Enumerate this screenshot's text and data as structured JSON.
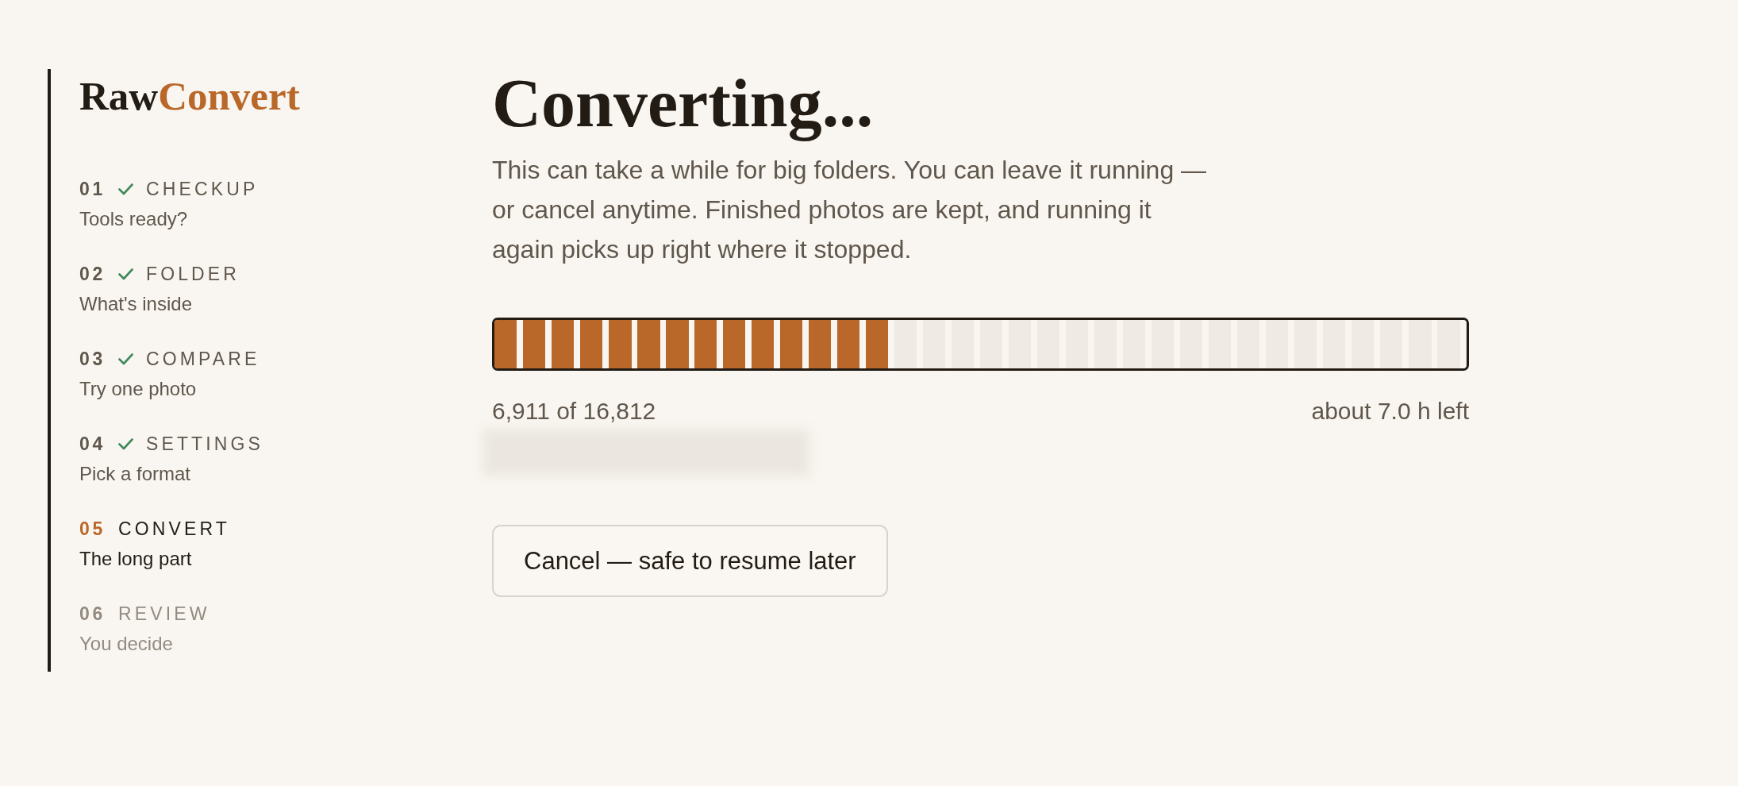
{
  "sidebar": {
    "logo": {
      "text": "Raw",
      "accent": "Convert"
    },
    "steps": [
      {
        "number": "01",
        "title": "CHECKUP",
        "subtitle": "Tools ready?",
        "completed": true,
        "selected": false
      },
      {
        "number": "02",
        "title": "FOLDER",
        "subtitle": "What's inside",
        "completed": true,
        "selected": false
      },
      {
        "number": "03",
        "title": "COMPARE",
        "subtitle": "Try one photo",
        "completed": true,
        "selected": false
      },
      {
        "number": "04",
        "title": "SETTINGS",
        "subtitle": "Pick a format",
        "completed": true,
        "selected": false
      },
      {
        "number": "05",
        "title": "CONVERT",
        "subtitle": "The long part",
        "completed": false,
        "selected": true
      },
      {
        "number": "06",
        "title": "REVIEW",
        "subtitle": "You decide",
        "completed": false,
        "selected": false
      }
    ]
  },
  "main": {
    "title": "Converting...",
    "description": "This can take a while for big folders. You can leave it running — or cancel anytime. Finished photos are kept, and running it again picks up right where it stopped.",
    "progress": {
      "level": 0.411,
      "count": "6,911 of 16,812",
      "remaining": "about 7.0 h left"
    },
    "cancel_button": "Cancel — safe to resume later"
  }
}
